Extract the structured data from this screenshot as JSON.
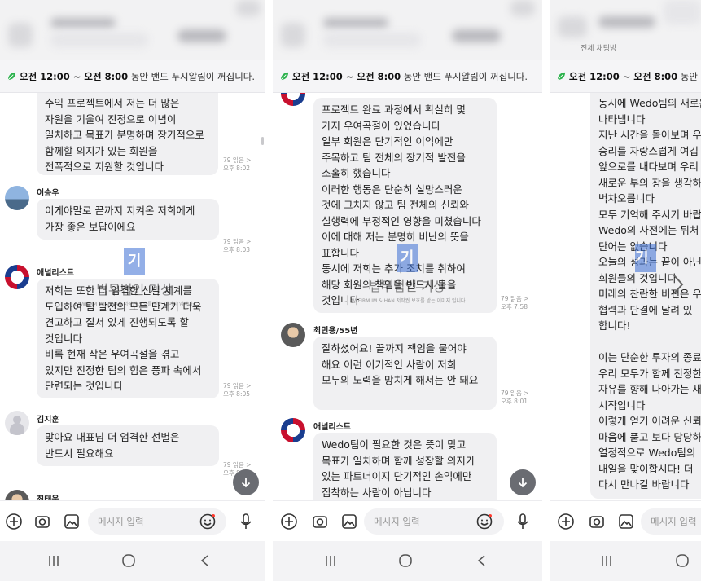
{
  "notice": {
    "time_range": "오전 12:00 ~ 오전 8:00",
    "suffix": " 동안 밴드 푸시알림이 꺼집니다.",
    "suffix_short": " 동안 밴"
  },
  "composer": {
    "placeholder": "메시지 입력",
    "placeholder_short": "메시지 입력"
  },
  "watermark": {
    "text": "법무법인 기상",
    "small": "LAWFIRM IM & HAN  저작권 보호를 받는 이미지 입니다."
  },
  "panel3_caption": "전체 채팅방",
  "panel1": {
    "messages": [
      {
        "sender": "",
        "text": "수익 프로젝트에서 저는 더 많은\n자원을 기울여 진정으로 이념이\n일치하고 목표가 분명하며 장기적으로\n함께할 의지가 있는 회원을\n전폭적으로 지원할 것입니다",
        "read": "79 읽음 >",
        "time": "오후 8:02"
      },
      {
        "sender": "이승우",
        "text": "이게야말로 끝까지 지켜온 저희에게\n가장 좋은 보답이에요",
        "read": "79 읽음 >",
        "time": "오후 8:03"
      },
      {
        "sender": "애널리스트",
        "text": "저희는 또한 더 엄격한 선발 체계를\n도입하여 팀 발전의 모든 단계가 더욱\n견고하고 질서 있게 진행되도록 할\n것입니다\n비록 현재 작은 우여곡절을 겪고\n있지만 진정한 팀의 힘은 풍파 속에서\n단련되는 것입니다",
        "read": "79 읽음 >",
        "time": "오후 8:05"
      },
      {
        "sender": "김지훈",
        "text": "맞아요 대표님 더 엄격한 선별은\n반드시 필요해요",
        "read": "79 읽음 >",
        "time": "오후 8:05"
      },
      {
        "sender": "최태웅",
        "text": "",
        "read": "",
        "time": ""
      }
    ]
  },
  "panel2": {
    "messages": [
      {
        "sender": "",
        "text": "프로젝트 완료 과정에서 확실히 몇\n가지 우여곡절이 있었습니다\n일부 회원은 단기적인 이익에만\n주목하고 팀 전체의 장기적 발전을\n소홀히 했습니다\n이러한 행동은 단순히 실망스러운\n것에 그치지 않고 팀 전체의 신뢰와\n실행력에 부정적인 영향을 미쳤습니다\n이에 대해 저는 분명히 비난의 뜻을\n표합니다\n동시에 저희는 추가 조치를 취하여\n해당 회원의 책임을 반드시 물을\n것입니다",
        "read": "79 읽음 >",
        "time": "오후 7:58"
      },
      {
        "sender": "최민용/55년",
        "text": "잘하셨어요! 끝까지 책임을 물어야\n해요 이런 이기적인 사람이 저희\n모두의 노력을 망치게 해서는 안 돼요",
        "read": "79 읽음 >",
        "time": "오후 8:01"
      },
      {
        "sender": "애널리스트",
        "text": "Wedo팀이 필요한 것은 뜻이 맞고\n목표가 일치하며 함께 성장할 의지가\n있는 파트너이지 단기적인 손익에만\n집착하는 사람이 아닙니다",
        "read": "",
        "time": ""
      }
    ]
  },
  "panel3": {
    "text": "동시에 Wedo팀의 새로운\n나타냅니다\n지난 시간을 돌아보며 우\n승리를 자랑스럽게 여깁\n앞으로를 내다보며 우리\n새로운 부의 장을 생각하\n벅차오릅니다\n모두 기억해 주시기 바랍\nWedo의 사전에는 뒤처\n단어는 없습니다\n오늘의 성과는 끝이 아닌\n회원들의 것입니다\n미래의 찬란한 비전은 우\n협력과 단결에 달려 있\n합니다!\n\n이는 단순한 투자의 종료\n우리 모두가 함께 진정한\n자유를 향해 나아가는 새\n시작입니다\n이렇게 얻기 어려운 신뢰\n마음에 품고 보다 당당하\n열정적으로 Wedo팀의 \n내일을 맞이합시다! 더 \n다시 만나길 바랍니다"
  },
  "colors": {
    "bubble": "#f0f0f2",
    "accent_green": "#2bb24c",
    "scroll_button": "#6a6c72",
    "watermark_blue": "#3b6fd4"
  },
  "icons": [
    "leaf-icon",
    "plus-icon",
    "camera-icon",
    "gallery-icon",
    "emoji-icon",
    "mic-icon",
    "recent-apps-icon",
    "home-icon",
    "back-icon",
    "scroll-down-icon",
    "next-arrow-icon"
  ]
}
